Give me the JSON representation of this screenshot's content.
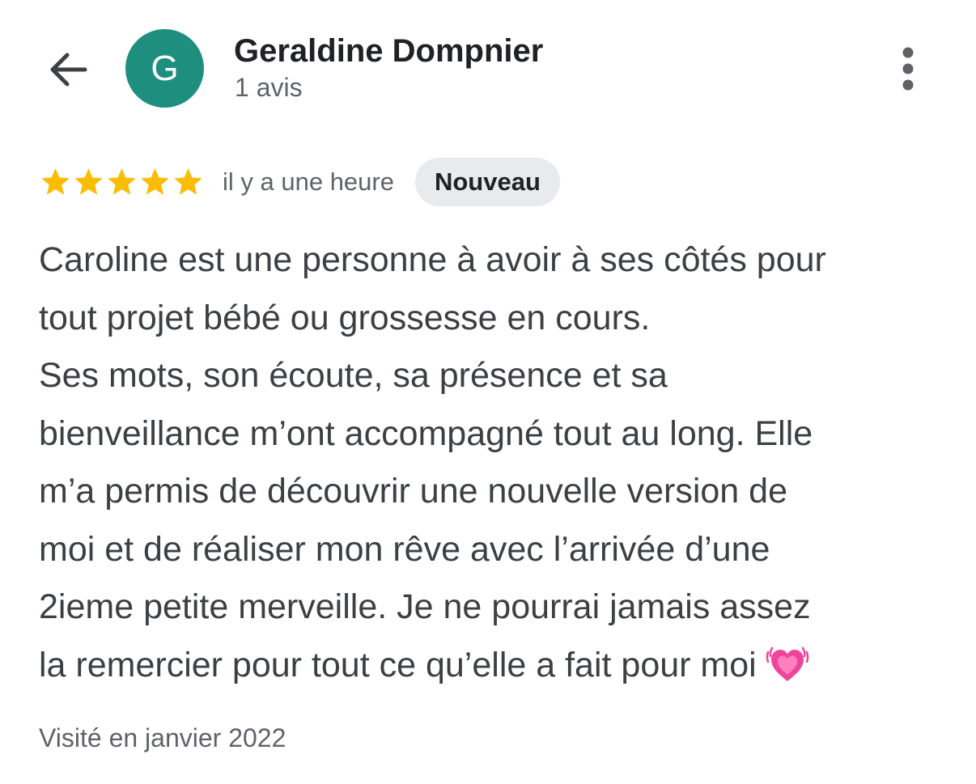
{
  "header": {
    "back_icon": "arrow-left-icon",
    "avatar_letter": "G",
    "avatar_color": "#1e8f7e",
    "reviewer_name": "Geraldine Dompnier",
    "review_count": "1 avis",
    "more_icon": "more-vertical-icon"
  },
  "review": {
    "rating": 5,
    "rating_max": 5,
    "star_color": "#fbbc04",
    "time_ago": "il y a une heure",
    "badge": "Nouveau",
    "lines": [
      "Caroline est une personne à avoir à ses côtés pour",
      "tout projet bébé ou grossesse en cours.",
      "Ses mots, son écoute, sa présence et sa",
      "bienveillance m’ont accompagné tout au long. Elle",
      "m’a permis de découvrir une nouvelle version de",
      "moi et de réaliser mon rêve avec l’arrivée d’une",
      "2ieme petite merveille. Je ne pourrai jamais assez",
      "la remercier pour tout ce qu’elle a fait pour moi"
    ],
    "emoji": "growing-heart-icon",
    "visited": "Visité en janvier 2022"
  }
}
